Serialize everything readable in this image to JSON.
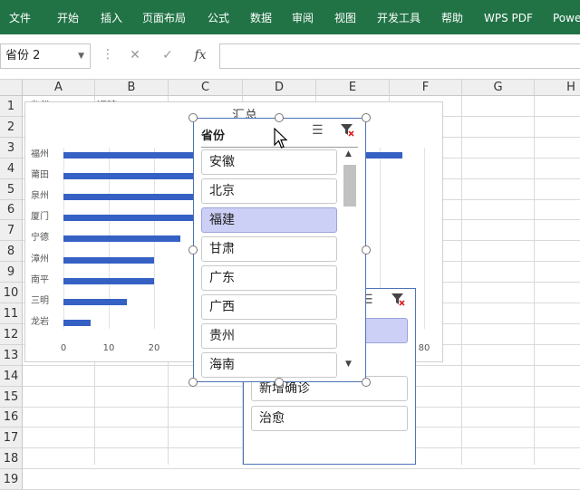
{
  "ribbon": {
    "bg": "#217346",
    "tabs": [
      "文件",
      "开始",
      "插入",
      "页面布局",
      "公式",
      "数据",
      "审阅",
      "视图",
      "开发工具",
      "帮助",
      "WPS PDF",
      "Powe"
    ]
  },
  "formula_bar": {
    "name_box": "省份 2",
    "fx_label": "fx",
    "formula": ""
  },
  "grid": {
    "columns": [
      "A",
      "B",
      "C",
      "D",
      "E",
      "F",
      "G",
      "H"
    ],
    "rows": [
      "1",
      "2",
      "3",
      "4",
      "5",
      "6",
      "7",
      "8",
      "9",
      "10",
      "11",
      "12",
      "13",
      "14",
      "15",
      "16",
      "17",
      "18",
      "19"
    ],
    "a1": "省份",
    "b1": "福建",
    "c1": "汇总"
  },
  "chart": {
    "bar_color": "#3561c4",
    "chart_data": {
      "type": "bar",
      "orientation": "horizontal",
      "title": "汇总",
      "categories": [
        "福州",
        "莆田",
        "泉州",
        "厦门",
        "宁德",
        "漳州",
        "南平",
        "三明",
        "龙岩"
      ],
      "values": [
        75,
        50,
        50,
        45,
        26,
        20,
        20,
        14,
        6
      ],
      "xlim": [
        0,
        80
      ],
      "x_ticks": [
        "0",
        "10",
        "20",
        "30",
        "40",
        "50",
        "60",
        "70",
        "80"
      ],
      "visible_x_ticks": [
        "0",
        "10",
        "20",
        "80"
      ],
      "grid": true,
      "legend": "none"
    }
  },
  "slicer_front": {
    "title": "省份",
    "items": [
      "安徽",
      "北京",
      "福建",
      "甘肃",
      "广东",
      "广西",
      "贵州",
      "海南"
    ],
    "selected": "福建",
    "selected_color": "#cdd0f6"
  },
  "slicer_back": {
    "items": [
      "新增确诊",
      "治愈"
    ]
  }
}
